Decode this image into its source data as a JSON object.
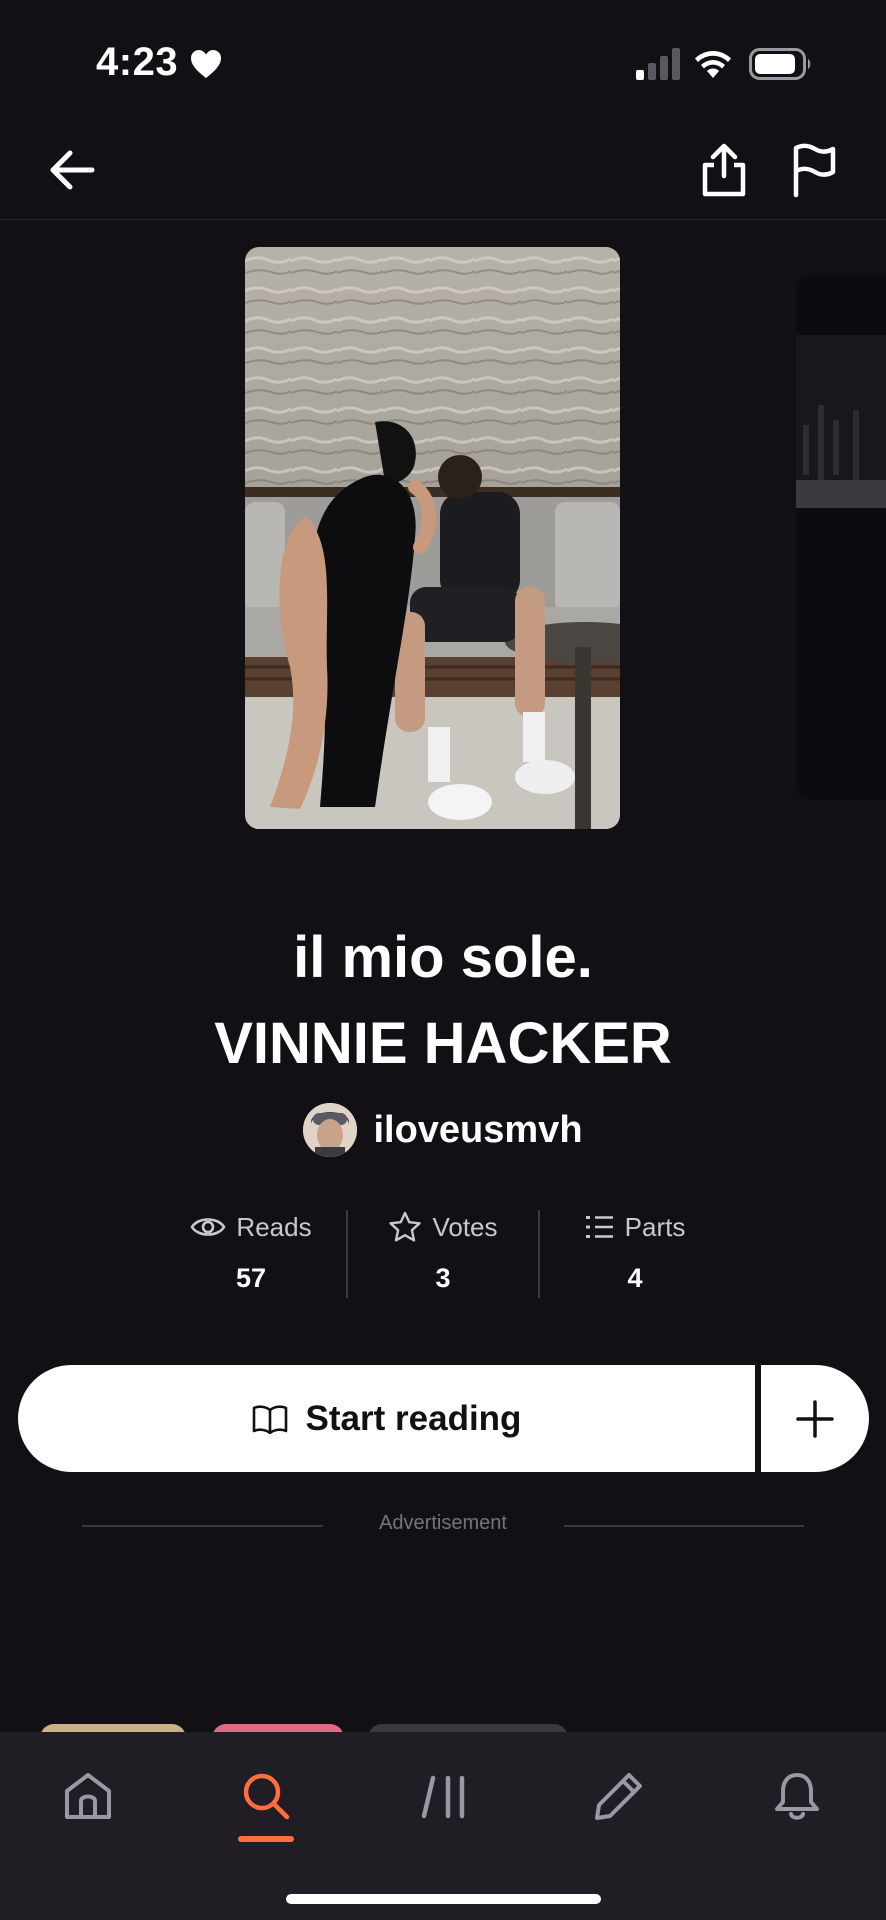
{
  "status_bar": {
    "time": "4:23",
    "heart_icon": "heart-icon",
    "signal_icon": "cellular-signal-icon",
    "wifi_icon": "wifi-icon",
    "battery_icon": "battery-icon"
  },
  "top_nav": {
    "back_icon": "arrow-left-icon",
    "share_icon": "share-icon",
    "report_icon": "flag-icon"
  },
  "story": {
    "title_line1": "il mio sole.",
    "title_line2": "VINNIE HACKER",
    "author": "iloveusmvh"
  },
  "stats": [
    {
      "icon": "eye-icon",
      "label": "Reads",
      "value": "57"
    },
    {
      "icon": "star-icon",
      "label": "Votes",
      "value": "3"
    },
    {
      "icon": "list-icon",
      "label": "Parts",
      "value": "4"
    }
  ],
  "actions": {
    "start_label": "Start reading",
    "start_icon": "open-book-icon",
    "add_icon": "plus-icon"
  },
  "ad": {
    "label": "Advertisement"
  },
  "bottom_nav": {
    "tabs": [
      {
        "icon": "home-icon",
        "active": false
      },
      {
        "icon": "search-icon",
        "active": true
      },
      {
        "icon": "library-icon",
        "active": false
      },
      {
        "icon": "pencil-icon",
        "active": false
      },
      {
        "icon": "bell-icon",
        "active": false
      }
    ],
    "accent_color": "#ff6e3c"
  },
  "colors": {
    "background": "#121015",
    "nav_background": "#201e24",
    "accent": "#ff6e3c"
  }
}
